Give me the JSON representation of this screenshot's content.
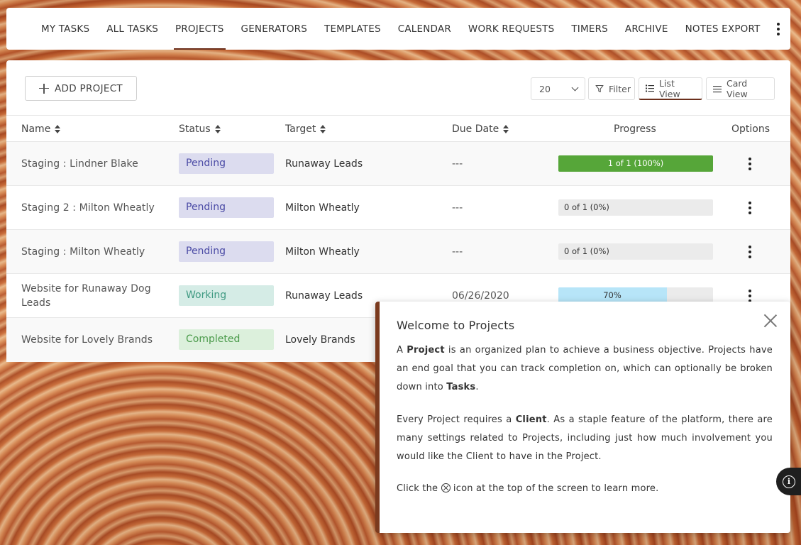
{
  "nav": {
    "items": [
      {
        "label": "MY TASKS",
        "active": false
      },
      {
        "label": "ALL TASKS",
        "active": false
      },
      {
        "label": "PROJECTS",
        "active": true
      },
      {
        "label": "GENERATORS",
        "active": false
      },
      {
        "label": "TEMPLATES",
        "active": false
      },
      {
        "label": "CALENDAR",
        "active": false
      },
      {
        "label": "WORK REQUESTS",
        "active": false
      },
      {
        "label": "TIMERS",
        "active": false
      },
      {
        "label": "ARCHIVE",
        "active": false
      },
      {
        "label": "NOTES EXPORT",
        "active": false
      }
    ],
    "more_icon": "more-vertical-icon"
  },
  "toolbar": {
    "add_label": "ADD PROJECT",
    "per_page": "20",
    "filter_label": "Filter",
    "list_view_label": "List View",
    "card_view_label": "Card View",
    "active_view": "List View"
  },
  "table": {
    "headers": {
      "name": "Name",
      "status": "Status",
      "target": "Target",
      "due": "Due Date",
      "progress": "Progress",
      "options": "Options"
    },
    "rows": [
      {
        "name": "Staging : Lindner Blake",
        "status": "Pending",
        "target": "Runaway Leads",
        "due": "---",
        "progress_text": "1 of 1 (100%)",
        "progress": 100
      },
      {
        "name": "Staging 2 : Milton Wheatly",
        "status": "Pending",
        "target": "Milton Wheatly",
        "due": "---",
        "progress_text": "0 of 1 (0%)",
        "progress": 0
      },
      {
        "name": "Staging : Milton Wheatly",
        "status": "Pending",
        "target": "Milton Wheatly",
        "due": "---",
        "progress_text": "0 of 1 (0%)",
        "progress": 0
      },
      {
        "name": "Website for Runaway Dog Leads",
        "status": "Working",
        "target": "Runaway Leads",
        "due": "06/26/2020",
        "progress_text": "70%",
        "progress": 70
      },
      {
        "name": "Website for Lovely Brands",
        "status": "Completed",
        "target": "Lovely Brands",
        "due": "",
        "progress_text": "",
        "progress": null
      }
    ]
  },
  "welcome": {
    "title": "Welcome to Projects",
    "p1": {
      "a": "A ",
      "b1": "Project",
      "c": " is an organized plan to achieve a business objective. Projects have an end goal that you can track completion on, which can optionally be broken down into ",
      "b2": "Tasks",
      "d": "."
    },
    "p2": {
      "a": "Every Project requires a ",
      "b1": "Client",
      "c": ". As a staple feature of the platform, there are many settings related to Projects, including just how much involvement you would like the Client to have in the Project."
    },
    "p3": {
      "a": "Click the ",
      "c": " icon at the top of the screen to learn more."
    }
  },
  "colors": {
    "accent": "#6b2f1c",
    "progress_green": "#56a639",
    "progress_blue": "#b7e5f8",
    "pending_bg": "#dcdcef",
    "working_bg": "#d5ece6",
    "completed_bg": "#dcf0dc"
  }
}
